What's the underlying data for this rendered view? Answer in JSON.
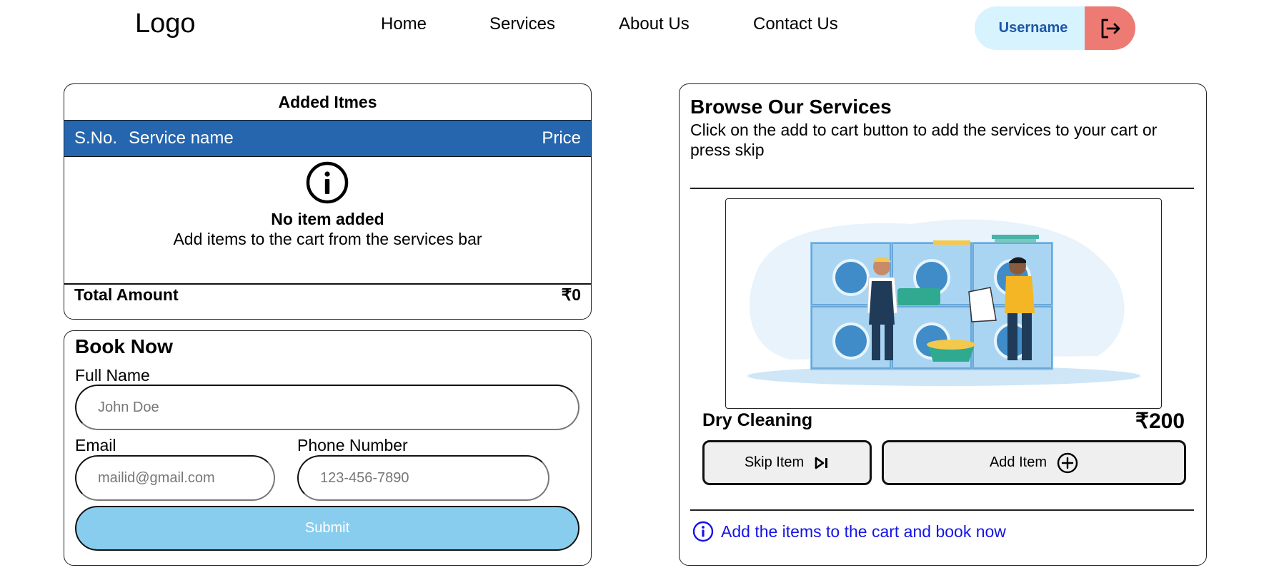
{
  "header": {
    "logo": "Logo",
    "nav": [
      "Home",
      "Services",
      "About Us",
      "Contact Us"
    ],
    "username": "Username",
    "logout_icon": "logout-icon"
  },
  "cart": {
    "title": "Added Itmes",
    "columns": {
      "sno": "S.No.",
      "service": "Service name",
      "price": "Price"
    },
    "empty_title": "No item added",
    "empty_message": "Add items to the cart from the services bar",
    "total_label": "Total Amount",
    "total_value": "₹0"
  },
  "booking": {
    "title": "Book Now",
    "full_name_label": "Full Name",
    "full_name_placeholder": "John Doe",
    "email_label": "Email",
    "email_placeholder": "mailid@gmail.com",
    "phone_label": "Phone Number",
    "phone_placeholder": "123-456-7890",
    "submit_label": "Submit"
  },
  "services": {
    "title": "Browse Our Services",
    "subtitle": "Click on the add to cart button to add the services to your cart or press skip",
    "current": {
      "name": "Dry Cleaning",
      "price": "₹200",
      "image": "laundry-illustration"
    },
    "skip_label": "Skip Item",
    "add_label": "Add Item",
    "hint": "Add the items to the cart and book now"
  },
  "colors": {
    "table_header": "#2566af",
    "username_bg": "#d7f3fd",
    "logout_bg": "#ee7b73",
    "submit_bg": "#89cdee",
    "hint_text": "#1414e6"
  }
}
